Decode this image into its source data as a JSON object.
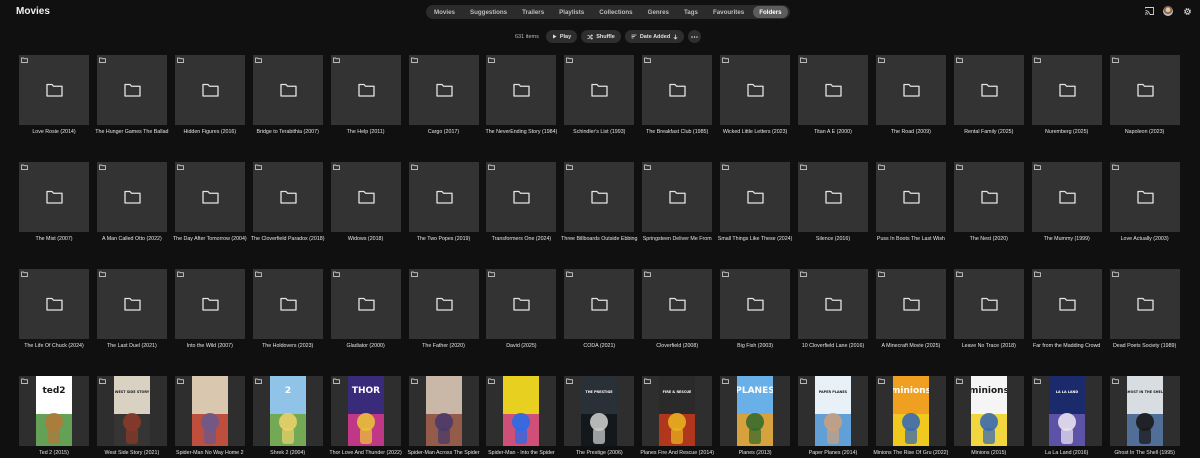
{
  "header": {
    "title": "Movies",
    "tabs": [
      {
        "label": "Movies",
        "active": false
      },
      {
        "label": "Suggestions",
        "active": false
      },
      {
        "label": "Trailers",
        "active": false
      },
      {
        "label": "Playlists",
        "active": false
      },
      {
        "label": "Collections",
        "active": false
      },
      {
        "label": "Genres",
        "active": false
      },
      {
        "label": "Tags",
        "active": false
      },
      {
        "label": "Favourites",
        "active": false
      },
      {
        "label": "Folders",
        "active": true
      }
    ],
    "icons": [
      "cast-icon",
      "avatar",
      "gear-icon"
    ]
  },
  "toolbar": {
    "count": "631 items",
    "play_label": "Play",
    "shuffle_label": "Shuffle",
    "sort_label": "Date Added",
    "more_icon": "more-horizontal-icon"
  },
  "colors": {
    "background": "#101010",
    "tile": "#333333",
    "active_tab": "#5c5c5c"
  },
  "items": [
    {
      "title": "Love Rosie (2014)"
    },
    {
      "title": "The Hunger Games The Ballad"
    },
    {
      "title": "Hidden Figures (2016)"
    },
    {
      "title": "Bridge to Terabithia (2007)"
    },
    {
      "title": "The Help (2011)"
    },
    {
      "title": "Cargo (2017)"
    },
    {
      "title": "The NeverEnding Story (1984)"
    },
    {
      "title": "Schindler's List (1993)"
    },
    {
      "title": "The Breakfast Club (1985)"
    },
    {
      "title": "Wicked Little Letters (2023)"
    },
    {
      "title": "Titan A E (2000)"
    },
    {
      "title": "The Road (2009)"
    },
    {
      "title": "Rental Family (2025)"
    },
    {
      "title": "Nuremberg (2025)"
    },
    {
      "title": "Napoleon (2023)"
    },
    {
      "title": "The Mist (2007)"
    },
    {
      "title": "A Man Called Otto (2022)"
    },
    {
      "title": "The Day After Tomorrow (2004)"
    },
    {
      "title": "The Cloverfield Paradox (2018)"
    },
    {
      "title": "Widows (2018)"
    },
    {
      "title": "The Two Popes (2019)"
    },
    {
      "title": "Transformers One (2024)"
    },
    {
      "title": "Three Billboards Outside Ebbing"
    },
    {
      "title": "Springsteen Deliver Me From"
    },
    {
      "title": "Small Things Like These (2024)"
    },
    {
      "title": "Silence (2016)"
    },
    {
      "title": "Puss In Boots The Last Wish"
    },
    {
      "title": "The Nest (2020)"
    },
    {
      "title": "The Mummy (1999)"
    },
    {
      "title": "Love Actually (2003)"
    },
    {
      "title": "The Life Of Chuck (2024)"
    },
    {
      "title": "The Last Duel (2021)"
    },
    {
      "title": "Into the Wild (2007)"
    },
    {
      "title": "The Holdovers (2023)"
    },
    {
      "title": "Gladiator (2000)"
    },
    {
      "title": "The Father (2020)"
    },
    {
      "title": "David (2025)"
    },
    {
      "title": "CODA (2021)"
    },
    {
      "title": "Cloverfield (2008)"
    },
    {
      "title": "Big Fish (2003)"
    },
    {
      "title": "10 Cloverfield Lane (2016)"
    },
    {
      "title": "A Minecraft Movie (2025)"
    },
    {
      "title": "Leave No Trace (2018)"
    },
    {
      "title": "Far from the Madding Crowd"
    },
    {
      "title": "Dead Poets Society (1989)"
    },
    {
      "title": "Ted 2 (2015)",
      "poster": "ted2",
      "poster_text": "ted2",
      "colors": [
        "#ffffff",
        "#4a8f3a",
        "#b07a3a"
      ]
    },
    {
      "title": "West Side Story (2021)",
      "poster": "wss",
      "poster_text": "WEST SIDE STORY",
      "colors": [
        "#d9d2c2",
        "#1a1a1a",
        "#8a3a2a"
      ]
    },
    {
      "title": "Spider-Man No Way Home 2",
      "poster": "sm",
      "colors": [
        "#d9c7b0",
        "#b8382a",
        "#6b5a8c"
      ]
    },
    {
      "title": "Shrek 2 (2004)",
      "poster": "shrek",
      "poster_text": "2",
      "colors": [
        "#8fc3e8",
        "#6fa33a",
        "#e8d06a"
      ]
    },
    {
      "title": "Thor Love And Thunder (2022)",
      "poster": "thor",
      "poster_text": "THOR",
      "colors": [
        "#3a2a7a",
        "#d93a8a",
        "#e8c03a"
      ]
    },
    {
      "title": "Spider-Man Across The Spider",
      "poster": "smas",
      "colors": [
        "#c9b8a8",
        "#8c4a3a",
        "#4a3a6a"
      ]
    },
    {
      "title": "Spider-Man - Into the Spider",
      "poster": "smis",
      "colors": [
        "#e8d020",
        "#c93a8a",
        "#2a6ae8"
      ]
    },
    {
      "title": "The Prestige (2006)",
      "poster": "prestige",
      "poster_text": "THE PRESTIGE",
      "colors": [
        "#2a3038",
        "#0f1418",
        "#c9c9c9"
      ]
    },
    {
      "title": "Planes Fire And Rescue (2014)",
      "poster": "pfr",
      "poster_text": "FIRE & RESCUE",
      "colors": [
        "#2a2a2a",
        "#c93a1a",
        "#e8b020"
      ]
    },
    {
      "title": "Planes (2013)",
      "poster": "planes",
      "poster_text": "PLANES",
      "colors": [
        "#6ab0e8",
        "#e8a020",
        "#3a6a2a"
      ]
    },
    {
      "title": "Paper Planes (2014)",
      "poster": "pp",
      "poster_text": "PAPER PLANES",
      "colors": [
        "#e8f0f8",
        "#4a90d0",
        "#c9a080"
      ]
    },
    {
      "title": "Minions The Rise Of Gru (2022)",
      "poster": "mrg",
      "poster_text": "minions",
      "colors": [
        "#f0a020",
        "#f0d020",
        "#3a6ab0"
      ]
    },
    {
      "title": "Minions (2015)",
      "poster": "min",
      "poster_text": "minions",
      "colors": [
        "#f5f5f5",
        "#f0d020",
        "#3a6ab0"
      ]
    },
    {
      "title": "La La Land (2016)",
      "poster": "lll",
      "poster_text": "LA LA LAND",
      "colors": [
        "#1a2a6a",
        "#6a5ab0",
        "#e8e0f0"
      ]
    },
    {
      "title": "Ghost In The Shell (1995)",
      "poster": "gits",
      "poster_text": "GHOST IN THE SHELL",
      "colors": [
        "#d8dde2",
        "#3a5a8a",
        "#1a1a1a"
      ]
    }
  ]
}
